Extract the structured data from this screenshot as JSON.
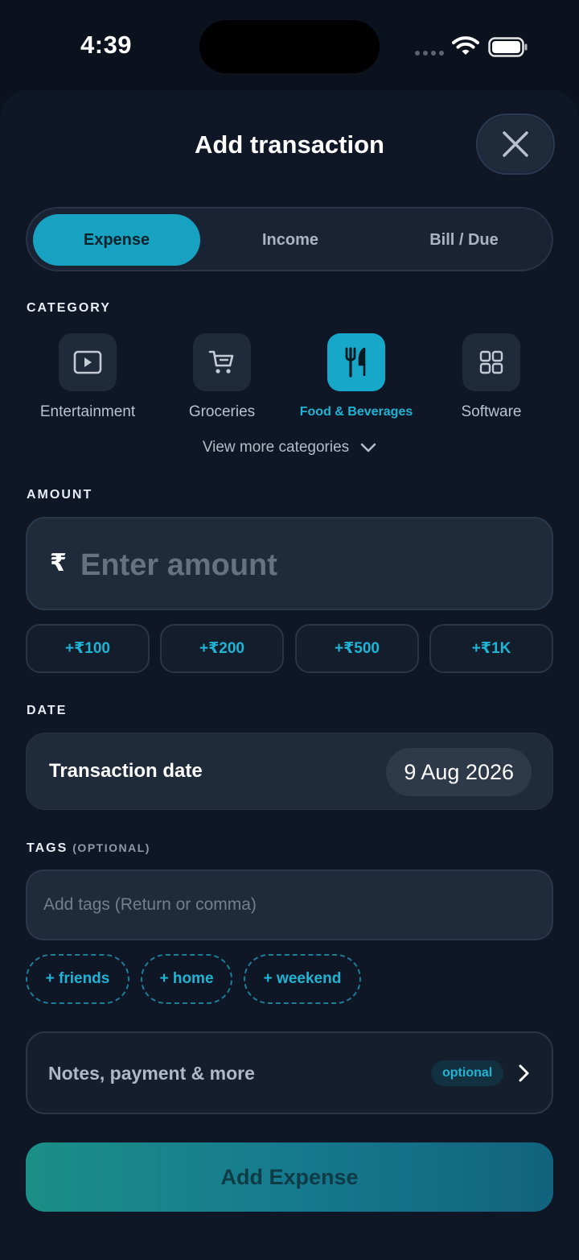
{
  "status_bar": {
    "time": "4:39"
  },
  "header": {
    "title": "Add transaction"
  },
  "type_tabs": [
    {
      "label": "Expense",
      "active": true
    },
    {
      "label": "Income",
      "active": false
    },
    {
      "label": "Bill / Due",
      "active": false
    }
  ],
  "category": {
    "label": "CATEGORY",
    "items": [
      {
        "label": "Entertainment",
        "icon": "play-icon",
        "active": false
      },
      {
        "label": "Groceries",
        "icon": "cart-icon",
        "active": false
      },
      {
        "label": "Food & Beverages",
        "icon": "fork-knife-icon",
        "active": true
      },
      {
        "label": "Software",
        "icon": "grid-icon",
        "active": false
      }
    ],
    "view_more": "View more categories"
  },
  "amount": {
    "label": "AMOUNT",
    "currency_symbol": "₹",
    "value": "",
    "placeholder": "Enter amount",
    "quick_add": [
      "+₹100",
      "+₹200",
      "+₹500",
      "+₹1K"
    ]
  },
  "date": {
    "label": "DATE",
    "field_label": "Transaction date",
    "value": "9 Aug 2026"
  },
  "tags": {
    "label": "TAGS",
    "sublabel": "(OPTIONAL)",
    "placeholder": "Add tags (Return or comma)",
    "suggestions": [
      "+ friends",
      "+ home",
      "+ weekend"
    ]
  },
  "notes": {
    "label": "Notes, payment & more",
    "badge": "optional"
  },
  "primary_action": {
    "label": "Add Expense"
  },
  "colors": {
    "accent": "#17a2c1",
    "background": "#0b111d",
    "sheet": "#0f1625"
  }
}
